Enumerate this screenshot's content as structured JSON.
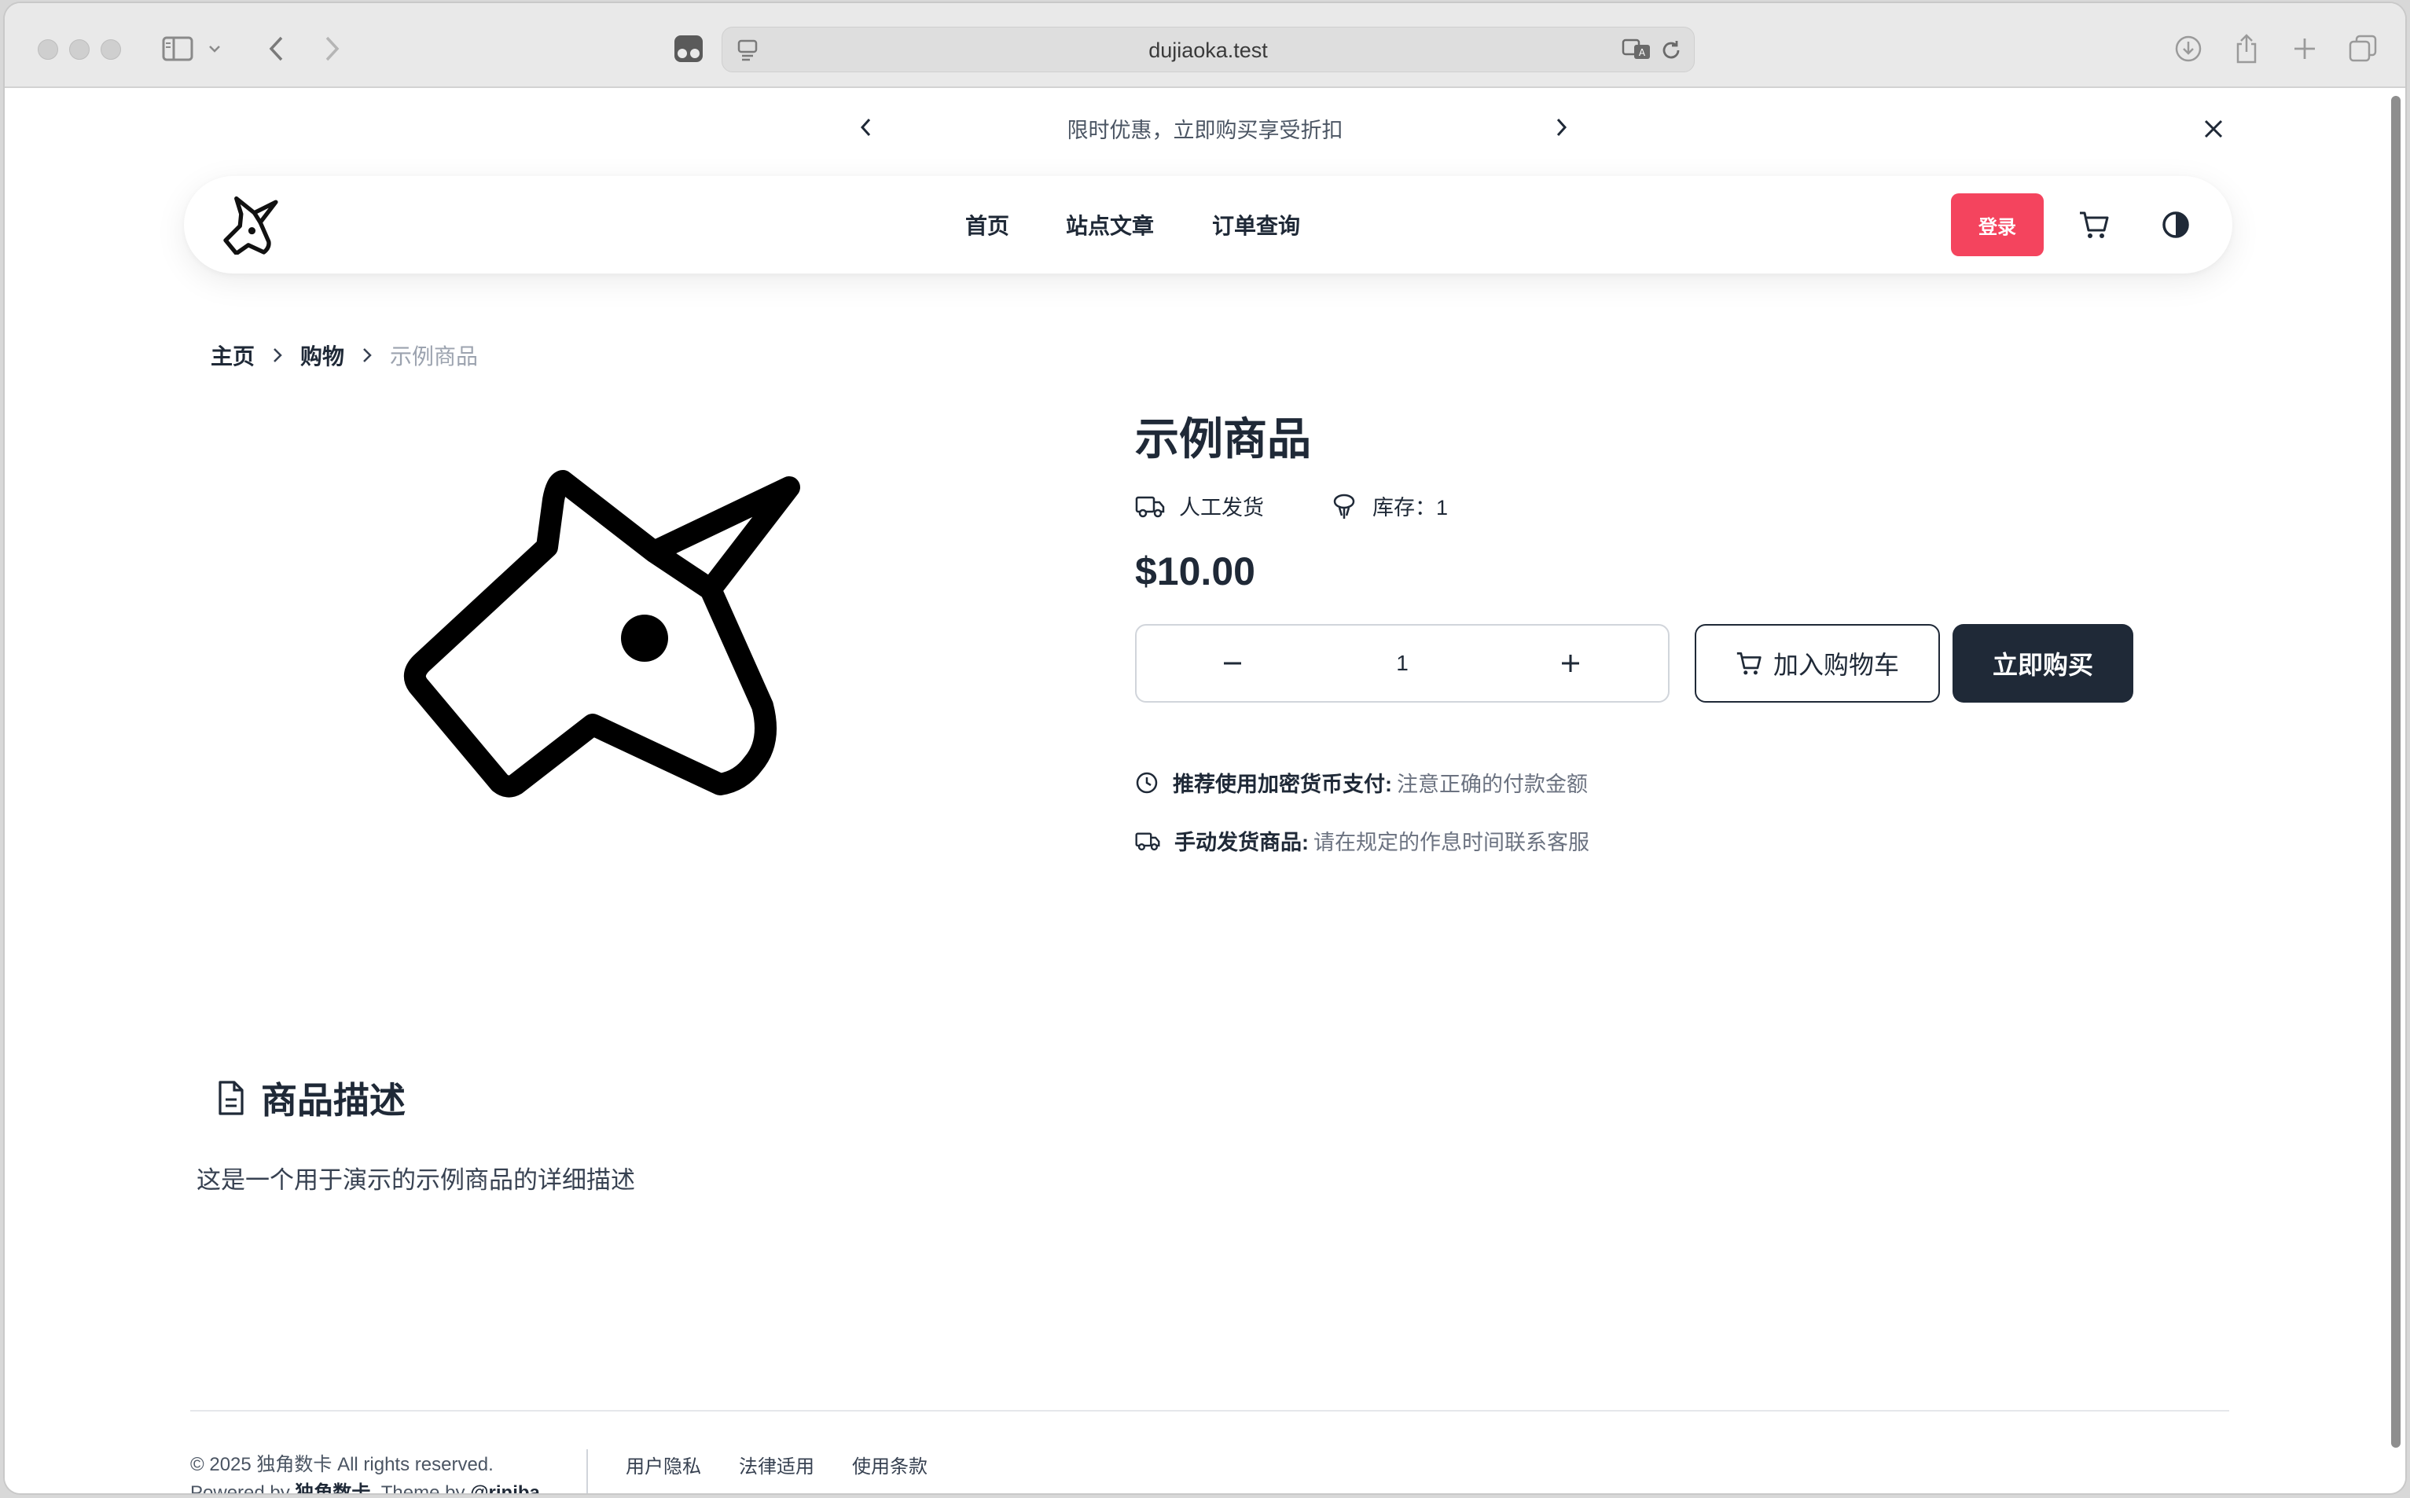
{
  "browser": {
    "url": "dujiaoka.test"
  },
  "announcement": {
    "text": "限时优惠，立即购买享受折扣"
  },
  "nav": {
    "links": [
      "首页",
      "站点文章",
      "订单查询"
    ],
    "login_label": "登录"
  },
  "breadcrumb": {
    "items": [
      "主页",
      "购物"
    ],
    "current": "示例商品"
  },
  "product": {
    "title": "示例商品",
    "delivery": "人工发货",
    "stock": "库存：1",
    "price": "$10.00",
    "quantity": "1",
    "add_to_cart": "加入购物车",
    "buy_now": "立即购买"
  },
  "tips": [
    {
      "label": "推荐使用加密货币支付:",
      "text": "注意正确的付款金额"
    },
    {
      "label": "手动发货商品:",
      "text": "请在规定的作息时间联系客服"
    }
  ],
  "description": {
    "title": "商品描述",
    "body": "这是一个用于演示的示例商品的详细描述"
  },
  "footer": {
    "copyright": "© 2025 独角数卡 All rights reserved.",
    "powered_prefix": "Powered by",
    "powered_name": "独角数卡",
    "theme_prefix": ". Theme by",
    "theme_name": "@riniba",
    "links": [
      "用户隐私",
      "法律适用",
      "使用条款"
    ]
  },
  "colors": {
    "accent": "#f4445e",
    "dark": "#1f2937"
  }
}
